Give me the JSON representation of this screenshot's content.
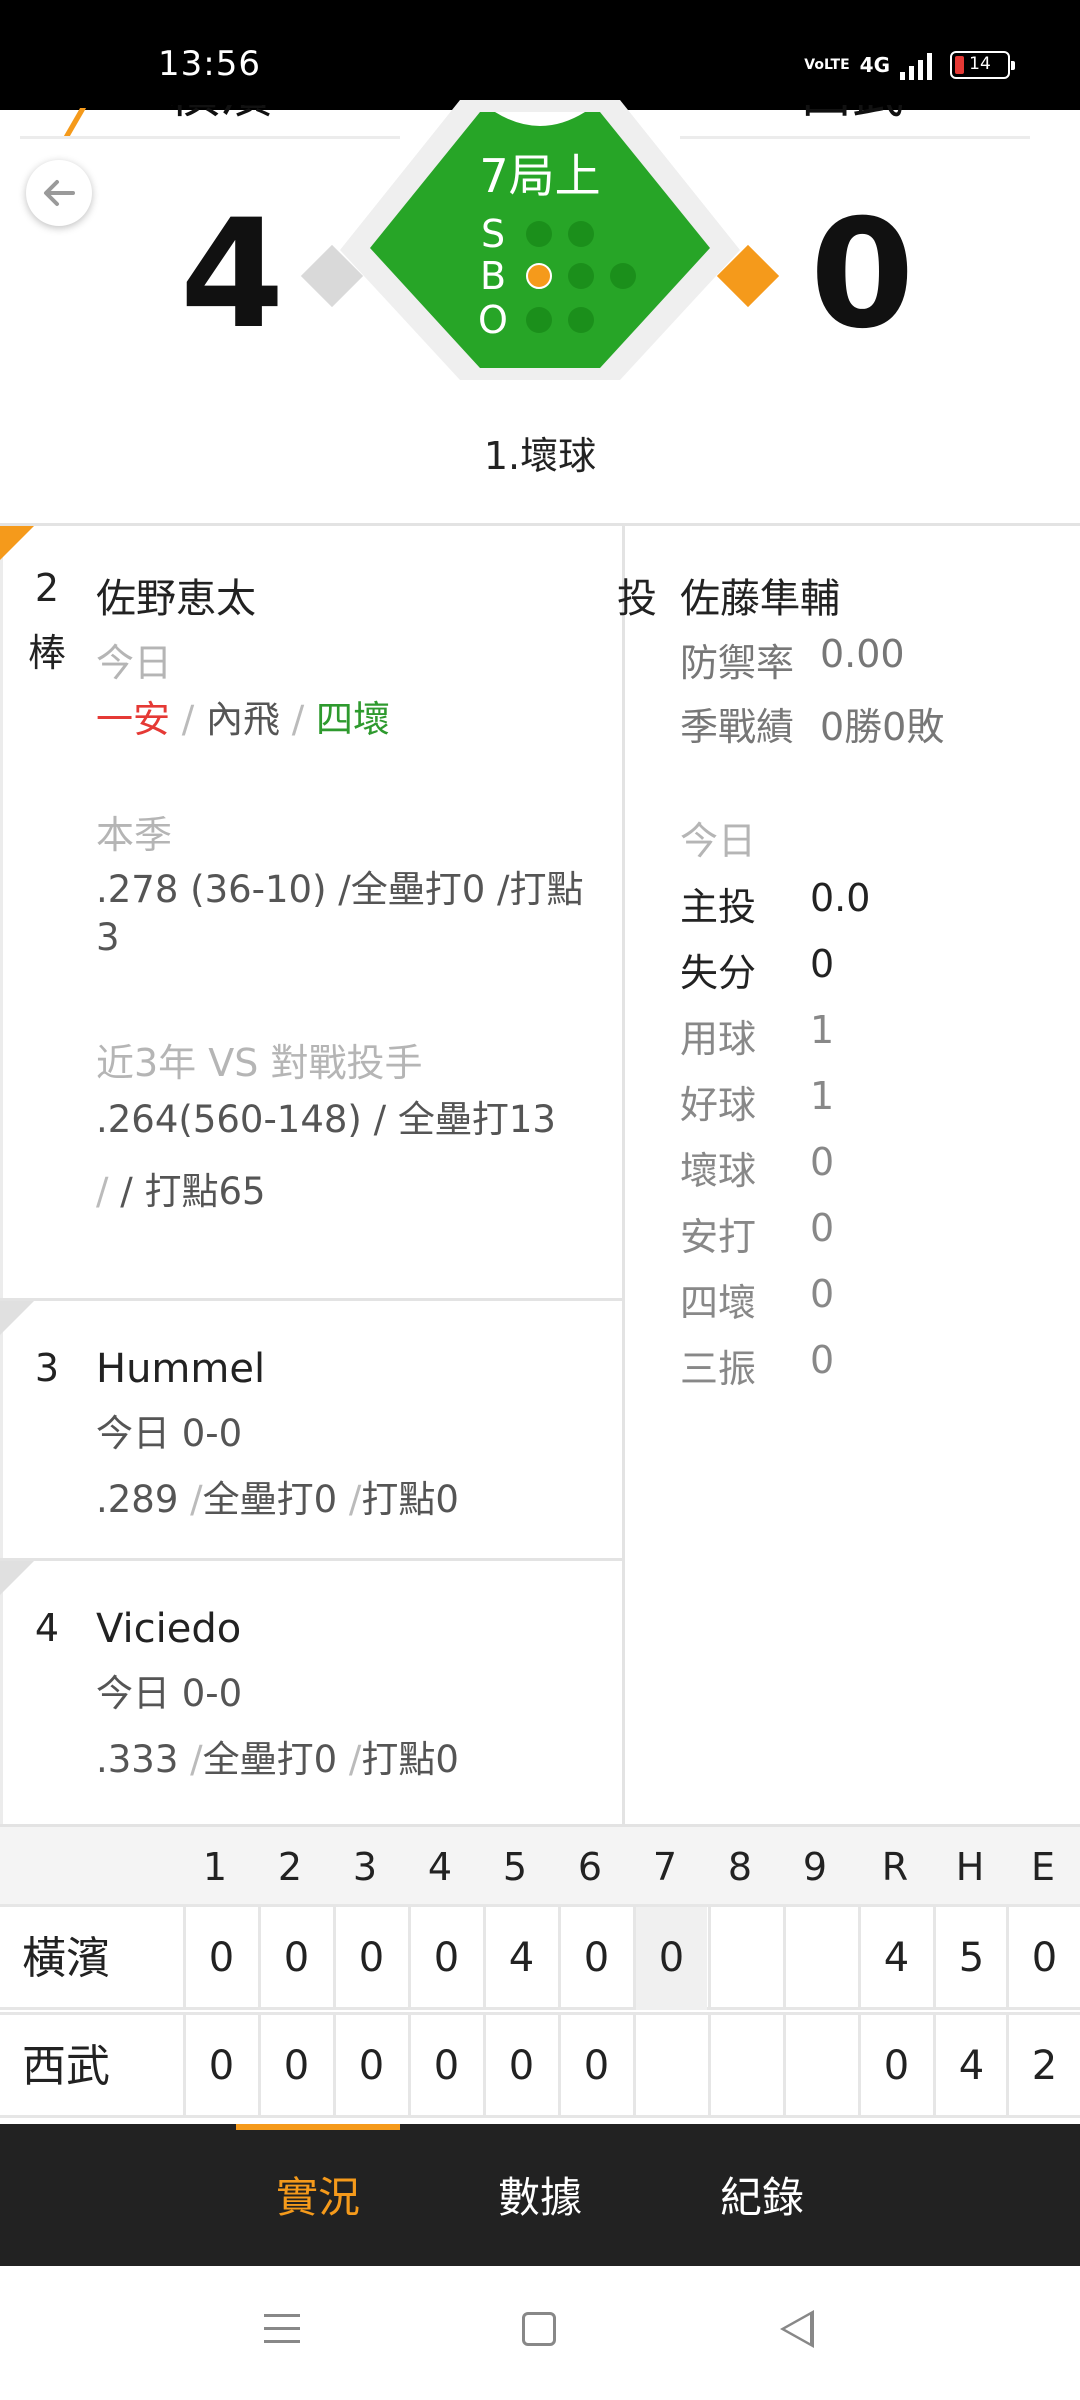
{
  "status_bar": {
    "time": "13:56",
    "network": "4G",
    "volte": "VoLTE",
    "battery": "14"
  },
  "game": {
    "home_team": "橫濱",
    "away_team": "西武",
    "home_score": "4",
    "away_score": "0",
    "inning": "7局上",
    "count_labels": [
      "S",
      "B",
      "O"
    ],
    "strikes": 0,
    "balls": 1,
    "outs": 0,
    "runner_on_first": true,
    "last_play": "1.壞球"
  },
  "current_batter": {
    "order": "2",
    "order_suffix": "棒",
    "name": "佐野恵太",
    "today_label": "今日",
    "today_results": [
      "一安",
      "內飛",
      "四壞"
    ],
    "season_label": "本季",
    "season_stats_line1": ".278 (36-10) /全壘打0 /打點",
    "season_stats_line2": "3",
    "vs_label": "近3年 VS 對戰投手",
    "vs_stats_line1": ".264(560-148) / 全壘打13",
    "vs_stats_line2": "/ 打點65"
  },
  "next_batters": [
    {
      "order": "3",
      "name": "Hummel",
      "today": "今日 0-0",
      "avg": ".289",
      "hr": "全壘打0",
      "rbi": "打點0"
    },
    {
      "order": "4",
      "name": "Viciedo",
      "today": "今日 0-0",
      "avg": ".333",
      "hr": "全壘打0",
      "rbi": "打點0"
    }
  ],
  "pitcher": {
    "role": "投",
    "name": "佐藤隼輔",
    "era_label": "防禦率",
    "era": "0.00",
    "record_label": "季戰績",
    "record": "0勝0敗",
    "today_label": "今日",
    "today_stats": [
      {
        "label": "主投",
        "value": "0.0"
      },
      {
        "label": "失分",
        "value": "0"
      },
      {
        "label": "用球",
        "value": "1"
      },
      {
        "label": "好球",
        "value": "1"
      },
      {
        "label": "壞球",
        "value": "0"
      },
      {
        "label": "安打",
        "value": "0"
      },
      {
        "label": "四壞",
        "value": "0"
      },
      {
        "label": "三振",
        "value": "0"
      }
    ]
  },
  "linescore": {
    "headers": [
      "1",
      "2",
      "3",
      "4",
      "5",
      "6",
      "7",
      "8",
      "9",
      "R",
      "H",
      "E"
    ],
    "rows": [
      {
        "team": "橫濱",
        "cells": [
          "0",
          "0",
          "0",
          "0",
          "4",
          "0",
          "0",
          "",
          "",
          "4",
          "5",
          "0"
        ]
      },
      {
        "team": "西武",
        "cells": [
          "0",
          "0",
          "0",
          "0",
          "0",
          "0",
          "",
          "",
          "",
          "0",
          "4",
          "2"
        ]
      }
    ]
  },
  "tabs": [
    "實況",
    "數據",
    "紀錄"
  ],
  "active_tab": "實況",
  "colors": {
    "accent": "#f59a1b",
    "field": "#27a527",
    "hit": "#e53935",
    "walk": "#2e9a2e"
  }
}
